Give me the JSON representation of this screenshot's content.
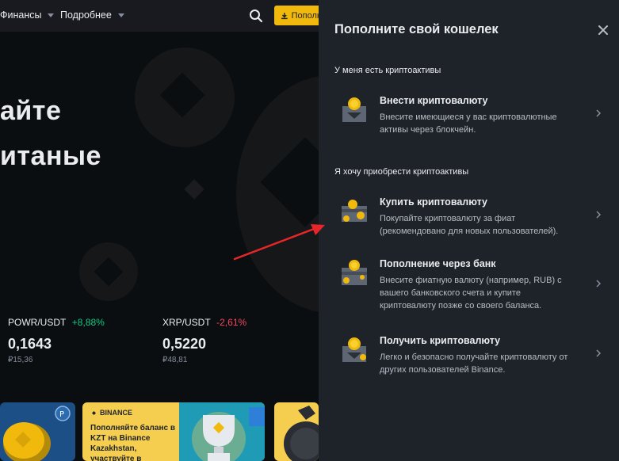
{
  "nav": {
    "items": [
      "Финансы",
      "Подробнее"
    ],
    "deposit_label": "Пополн"
  },
  "hero": {
    "title_line1": "айте",
    "title_line2": "итаные"
  },
  "tickers": [
    {
      "pair": "POWR/USDT",
      "change": "+8,88%",
      "price": "0,1643",
      "fiat": "₽15,36",
      "change_color": "#0ecb81"
    },
    {
      "pair": "XRP/USDT",
      "change": "-2,61%",
      "price": "0,5220",
      "fiat": "₽48,81",
      "change_color": "#f6465d"
    }
  ],
  "banners": {
    "kz_brand": "BINANCE",
    "kz_text": "Пополняйте баланс в KZT на Binance Kazakhstan, участвуйте в"
  },
  "drawer": {
    "title": "Пополните свой кошелек",
    "section_have": "У меня есть криптоактивы",
    "section_want": "Я хочу приобрести криптоактивы",
    "options": [
      {
        "title": "Внести криптовалюту",
        "desc": "Внесите имеющиеся у вас криптовалютные активы через блокчейн.",
        "icon": "deposit-crypto-icon"
      },
      {
        "title": "Купить криптовалюту",
        "desc": "Покупайте криптовалюту за фиат (рекомендовано для новых пользователей).",
        "icon": "buy-crypto-icon"
      },
      {
        "title": "Пополнение через банк",
        "desc": "Внесите фиатную валюту (например, RUB) с вашего банковского счета и купите криптовалюту позже со своего баланса.",
        "icon": "bank-deposit-icon"
      },
      {
        "title": "Получить криптовалюту",
        "desc": "Легко и безопасно получайте криптовалюту от других пользователей Binance.",
        "icon": "receive-crypto-icon"
      }
    ]
  },
  "colors": {
    "accent": "#f0b90b",
    "drawer_bg": "#1e2329",
    "annotation_arrow": "#e8262a"
  }
}
